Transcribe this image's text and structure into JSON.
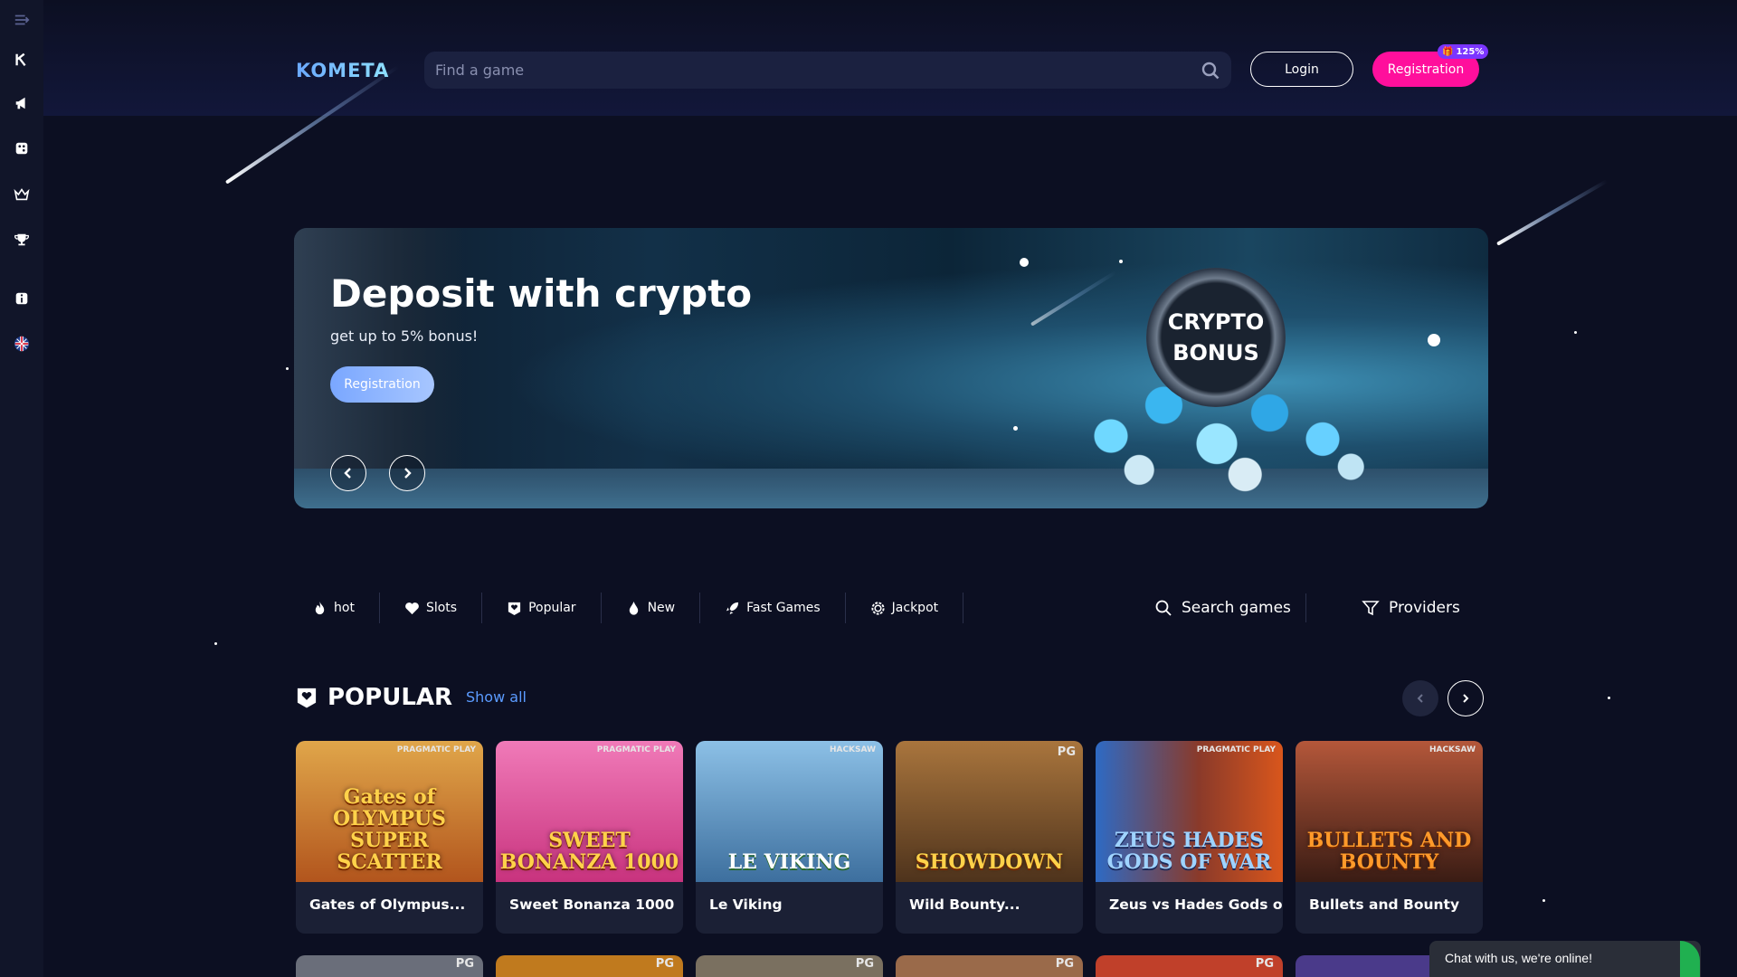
{
  "sidebar": {
    "items": [
      {
        "icon": "menu-collapse-icon"
      },
      {
        "icon": "kometa-k-icon"
      },
      {
        "icon": "megaphone-icon"
      },
      {
        "icon": "dice-icon"
      },
      {
        "icon": "crown-icon"
      },
      {
        "icon": "trophy-icon"
      },
      {
        "icon": "info-icon"
      },
      {
        "icon": "uk-flag-icon"
      }
    ]
  },
  "header": {
    "logo": "KOMETA",
    "search_placeholder": "Find a game",
    "login_label": "Login",
    "registration_label": "Registration",
    "registration_badge": "125%"
  },
  "banner": {
    "title": "Deposit with crypto",
    "subtitle": "get up to 5% bonus!",
    "cta_label": "Registration",
    "coin_line1": "CRYPTO",
    "coin_line2": "BONUS"
  },
  "categories": {
    "tabs": [
      {
        "label": "hot",
        "icon": "flame-icon"
      },
      {
        "label": "Slots",
        "icon": "heart-icon"
      },
      {
        "label": "Popular",
        "icon": "heart-badge-icon"
      },
      {
        "label": "New",
        "icon": "drop-flame-icon"
      },
      {
        "label": "Fast Games",
        "icon": "rocket-icon"
      },
      {
        "label": "Jackpot",
        "icon": "gear-icon"
      }
    ],
    "search_label": "Search games",
    "providers_label": "Providers"
  },
  "popular": {
    "title": "POPULAR",
    "show_all": "Show all",
    "games": [
      {
        "name": "Gates of Olympus...",
        "art": "Gates of OLYMPUS SUPER SCATTER",
        "provider": "PRAGMATIC PLAY",
        "bg": "#c4762a"
      },
      {
        "name": "Sweet Bonanza 1000",
        "art": "SWEET BONANZA 1000",
        "provider": "PRAGMATIC PLAY",
        "bg": "#e8559a"
      },
      {
        "name": "Le Viking",
        "art": "LE VIKING",
        "provider": "HACKSAW",
        "bg": "#4c84b8"
      },
      {
        "name": "Wild Bounty...",
        "art": "SHOWDOWN",
        "provider": "PG",
        "bg": "#6b4a2a"
      },
      {
        "name": "Zeus vs Hades Gods o...",
        "art": "ZEUS HADES GODS OF WAR",
        "provider": "PRAGMATIC PLAY",
        "bg": "#3568b4"
      },
      {
        "name": "Bullets and Bounty",
        "art": "BULLETS AND BOUNTY",
        "provider": "HACKSAW",
        "bg": "#8a3b24"
      }
    ],
    "row2_providers": [
      "PG",
      "PG",
      "PG",
      "PG",
      "PG",
      ""
    ]
  },
  "chat": {
    "label": "Chat with us, we're online!"
  },
  "colors": {
    "background": "#0c0f22",
    "accent_pink": "#ff0f9c",
    "link_blue": "#5b9bff",
    "badge_purple": "#7b35ff"
  }
}
